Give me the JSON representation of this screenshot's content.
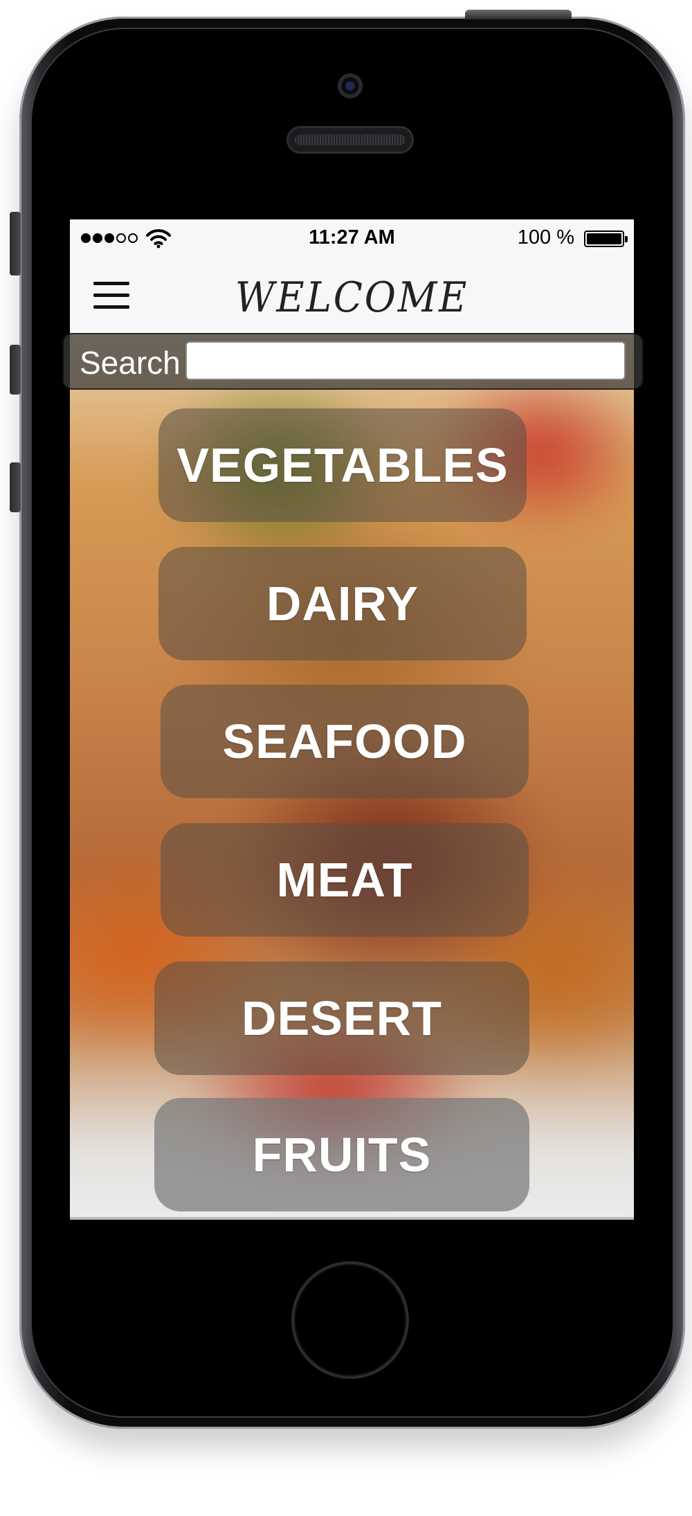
{
  "status_bar": {
    "time": "11:27 AM",
    "battery_text": "100 %",
    "signal_bars_filled": 3,
    "signal_bars_total": 5,
    "battery_level": 1.0
  },
  "nav": {
    "title": "WELCOME",
    "menu_icon": "hamburger-menu-icon"
  },
  "search": {
    "label": "Search",
    "value": "",
    "placeholder": ""
  },
  "categories": [
    {
      "label": "VEGETABLES"
    },
    {
      "label": "DAIRY"
    },
    {
      "label": "SEAFOOD"
    },
    {
      "label": "MEAT"
    },
    {
      "label": "DESERT"
    },
    {
      "label": "FRUITS"
    }
  ],
  "colors": {
    "phone_body": "#0b0b0c",
    "status_bg": "#f7f7f7",
    "search_bar_bg": "#3c3c3c",
    "button_overlay": "#5a4e46",
    "button_text": "#ffffff"
  }
}
